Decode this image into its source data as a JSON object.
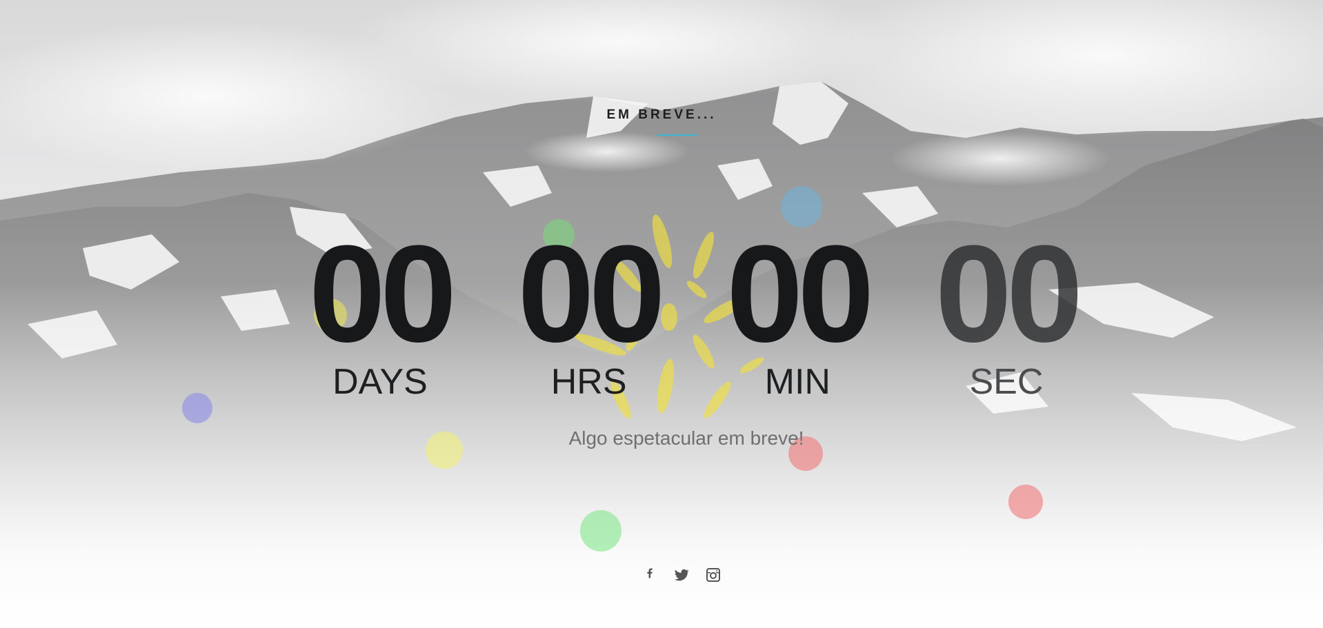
{
  "header": {
    "title": "EM BREVE..."
  },
  "countdown": {
    "units": [
      {
        "value": "00",
        "label": "DAYS"
      },
      {
        "value": "00",
        "label": "HRS"
      },
      {
        "value": "00",
        "label": "MIN"
      },
      {
        "value": "00",
        "label": "SEC"
      }
    ]
  },
  "tagline": "Algo espetacular em breve!",
  "social": [
    {
      "icon": "facebook-icon"
    },
    {
      "icon": "twitter-icon"
    },
    {
      "icon": "instagram-icon"
    }
  ],
  "colors": {
    "accent": "#3fb6d8",
    "text_dark": "#161819",
    "tagline": "#6f6f6f",
    "social": "#555555"
  }
}
